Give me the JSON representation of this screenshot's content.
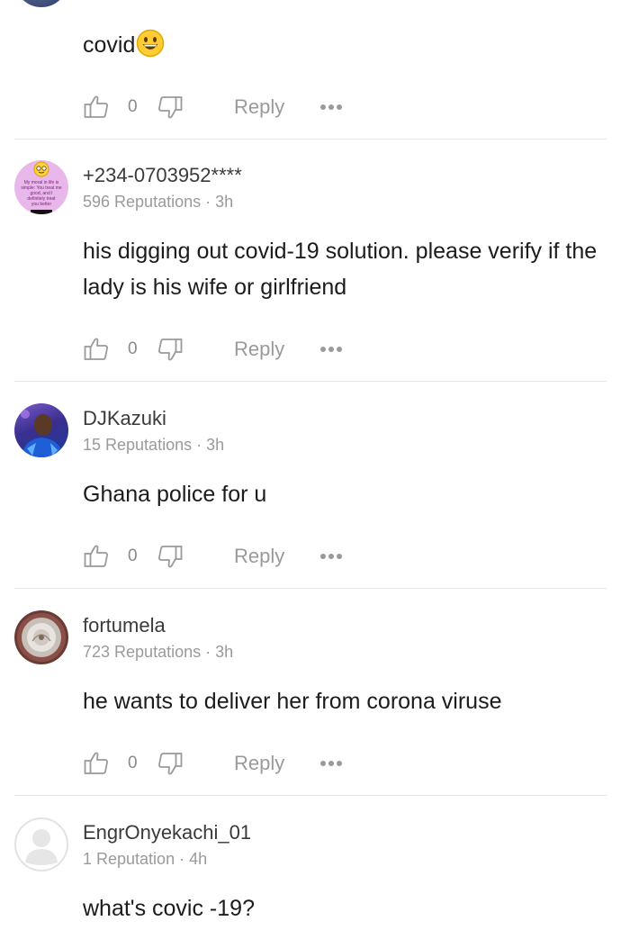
{
  "top_comment": {
    "text": "covid",
    "emoji": "grinning-face-emoji",
    "likes": "0",
    "reply_label": "Reply"
  },
  "comments": [
    {
      "username": "+234-0703952****",
      "reputation": "596 Reputations",
      "time": "3h",
      "avatar_text": "My moral in life is simple: You treat me good, and I definitely treat you better",
      "text": "his digging out covid-19 solution. please verify if the lady is his wife or girlfriend",
      "likes": "0",
      "reply_label": "Reply"
    },
    {
      "username": "DJKazuki",
      "reputation": "15 Reputations",
      "time": "3h",
      "text": "Ghana police for u",
      "likes": "0",
      "reply_label": "Reply"
    },
    {
      "username": "fortumela",
      "reputation": "723 Reputations",
      "time": "3h",
      "text": "he wants to deliver her from corona viruse",
      "likes": "0",
      "reply_label": "Reply"
    },
    {
      "username": "EngrOnyekachi_01",
      "reputation": "1 Reputation",
      "time": "4h",
      "text": "what's covic -19?"
    }
  ],
  "colors": {
    "divider": "#e6e6e6",
    "meta_text": "#9a9a9a",
    "body_text": "#1c1c1c"
  }
}
